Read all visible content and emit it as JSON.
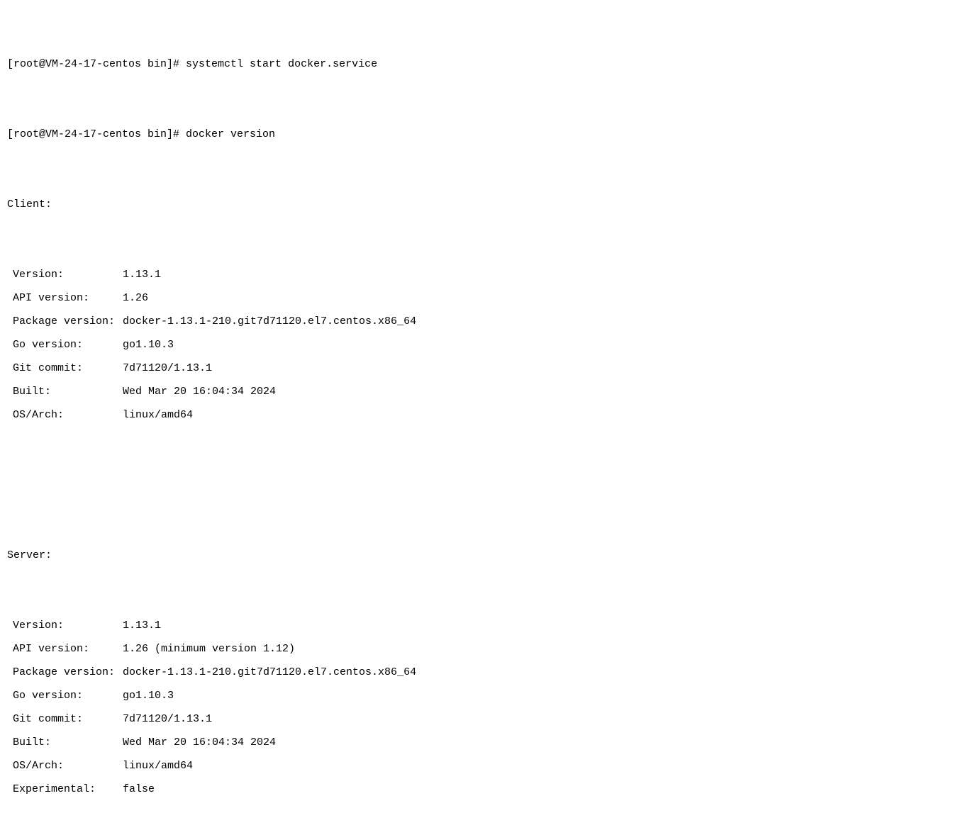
{
  "prompt1": "[root@VM-24-17-centos bin]# systemctl start docker.service",
  "prompt2": "[root@VM-24-17-centos bin]# docker version",
  "client": {
    "header": "Client:",
    "fields": [
      {
        "label": "Version:",
        "value": "1.13.1"
      },
      {
        "label": "API version:",
        "value": "1.26"
      },
      {
        "label": "Package version:",
        "value": "docker-1.13.1-210.git7d71120.el7.centos.x86_64"
      },
      {
        "label": "Go version:",
        "value": "go1.10.3"
      },
      {
        "label": "Git commit:",
        "value": "7d71120/1.13.1"
      },
      {
        "label": "Built:",
        "value": "Wed Mar 20 16:04:34 2024"
      },
      {
        "label": "OS/Arch:",
        "value": "linux/amd64"
      }
    ]
  },
  "server": {
    "header": "Server:",
    "fields": [
      {
        "label": "Version:",
        "value": "1.13.1"
      },
      {
        "label": "API version:",
        "value": "1.26 (minimum version 1.12)"
      },
      {
        "label": "Package version:",
        "value": "docker-1.13.1-210.git7d71120.el7.centos.x86_64"
      },
      {
        "label": "Go version:",
        "value": "go1.10.3"
      },
      {
        "label": "Git commit:",
        "value": "7d71120/1.13.1"
      },
      {
        "label": "Built:",
        "value": "Wed Mar 20 16:04:34 2024"
      },
      {
        "label": "OS/Arch:",
        "value": "linux/amd64"
      },
      {
        "label": "Experimental:",
        "value": "false"
      }
    ]
  }
}
